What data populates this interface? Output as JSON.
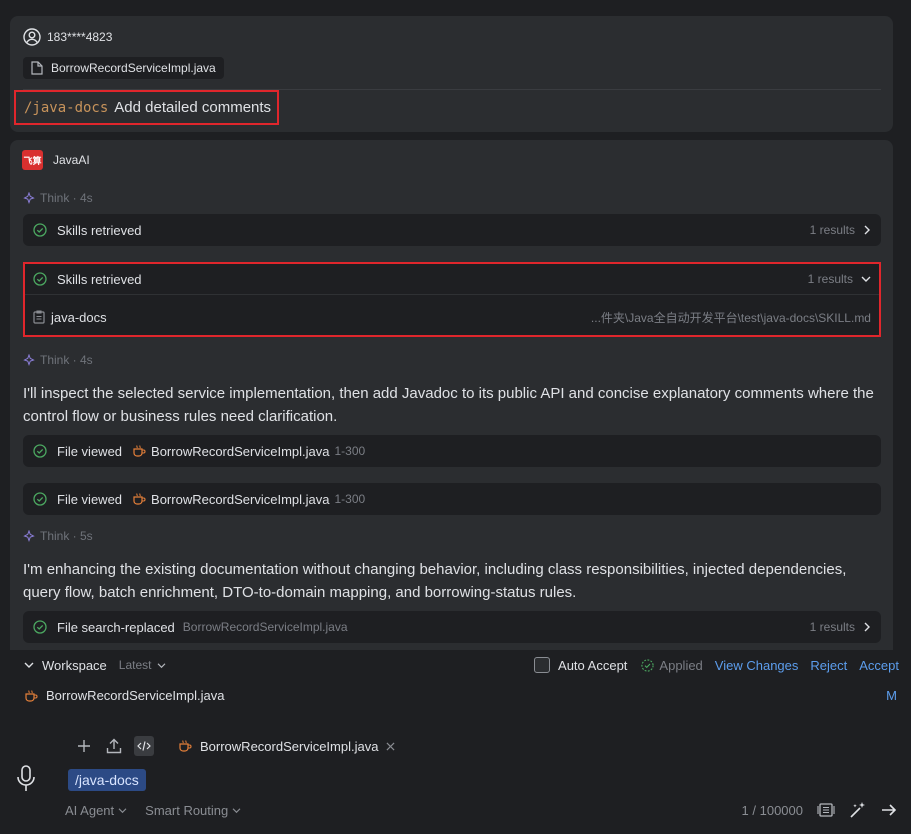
{
  "user_message": {
    "user": "183****4823",
    "attached_file": "BorrowRecordServiceImpl.java",
    "command": "/java-docs",
    "prompt": "Add detailed comments"
  },
  "ai": {
    "name": "JavaAI",
    "think1": "Think · 4s",
    "skills_collapsed": {
      "label": "Skills retrieved",
      "results": "1 results"
    },
    "skills_expanded": {
      "label": "Skills retrieved",
      "results": "1 results",
      "item_name": "java-docs",
      "item_path": "...件夹\\Java全自动开发平台\\test\\java-docs\\SKILL.md"
    },
    "think2": "Think · 4s",
    "paragraph1": "I'll inspect the selected service implementation, then add Javadoc to its public API and concise explanatory comments where the control flow or business rules need clarification.",
    "file_view_1": {
      "action": "File viewed",
      "file": "BorrowRecordServiceImpl.java",
      "range": "1-300"
    },
    "file_view_2": {
      "action": "File viewed",
      "file": "BorrowRecordServiceImpl.java",
      "range": "1-300"
    },
    "think3": "Think · 5s",
    "paragraph2": "I'm enhancing the existing documentation without changing behavior, including class responsibilities, injected dependencies, query flow, batch enrichment, DTO-to-domain mapping, and borrowing-status rules.",
    "search_replace": {
      "action": "File search-replaced",
      "file": "BorrowRecordServiceImpl.java",
      "results": "1 results"
    }
  },
  "workspace": {
    "title": "Workspace",
    "filter": "Latest",
    "auto_accept": "Auto Accept",
    "applied": "Applied",
    "view_changes": "View Changes",
    "reject": "Reject",
    "accept": "Accept",
    "changed_file": "BorrowRecordServiceImpl.java",
    "changed_status": "M"
  },
  "input": {
    "context_file": "BorrowRecordServiceImpl.java",
    "slash_command": "/java-docs",
    "agent_mode": "AI Agent",
    "routing": "Smart Routing",
    "char_count": "1 / 100000"
  },
  "colors": {
    "background": "#1e1f22",
    "card": "#2b2d30",
    "highlight_border": "#e0262c",
    "link": "#5c9ded",
    "success": "#4ca861",
    "command": "#c7935b"
  }
}
